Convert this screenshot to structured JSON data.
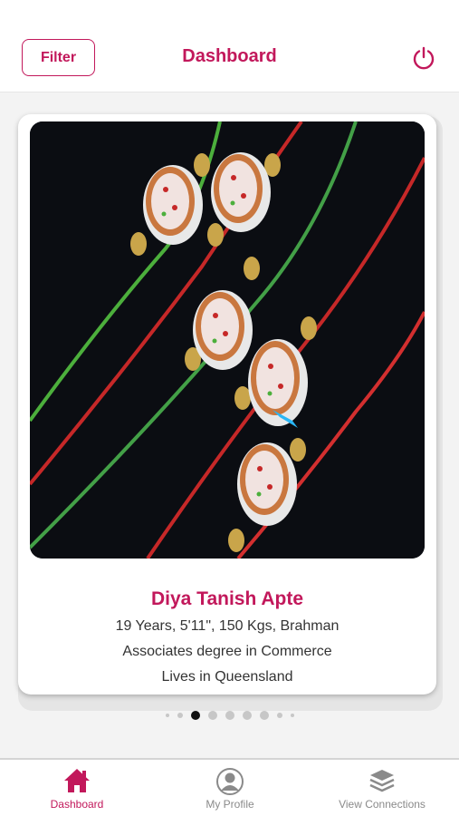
{
  "header": {
    "filter_label": "Filter",
    "title": "Dashboard",
    "power_icon": "power-icon"
  },
  "profile": {
    "name": "Diya Tanish Apte",
    "details": "19 Years, 5'11\", 150 Kgs, Brahman",
    "education": "Associates degree in Commerce",
    "location": "Lives in Queensland"
  },
  "carousel": {
    "total_dots": 9,
    "active_index": 2
  },
  "tabs": [
    {
      "label": "Dashboard",
      "icon": "home-icon",
      "active": true
    },
    {
      "label": "My Profile",
      "icon": "user-icon",
      "active": false
    },
    {
      "label": "View Connections",
      "icon": "layers-icon",
      "active": false
    }
  ],
  "colors": {
    "accent": "#c2185b",
    "inactive": "#8a8a8a"
  }
}
